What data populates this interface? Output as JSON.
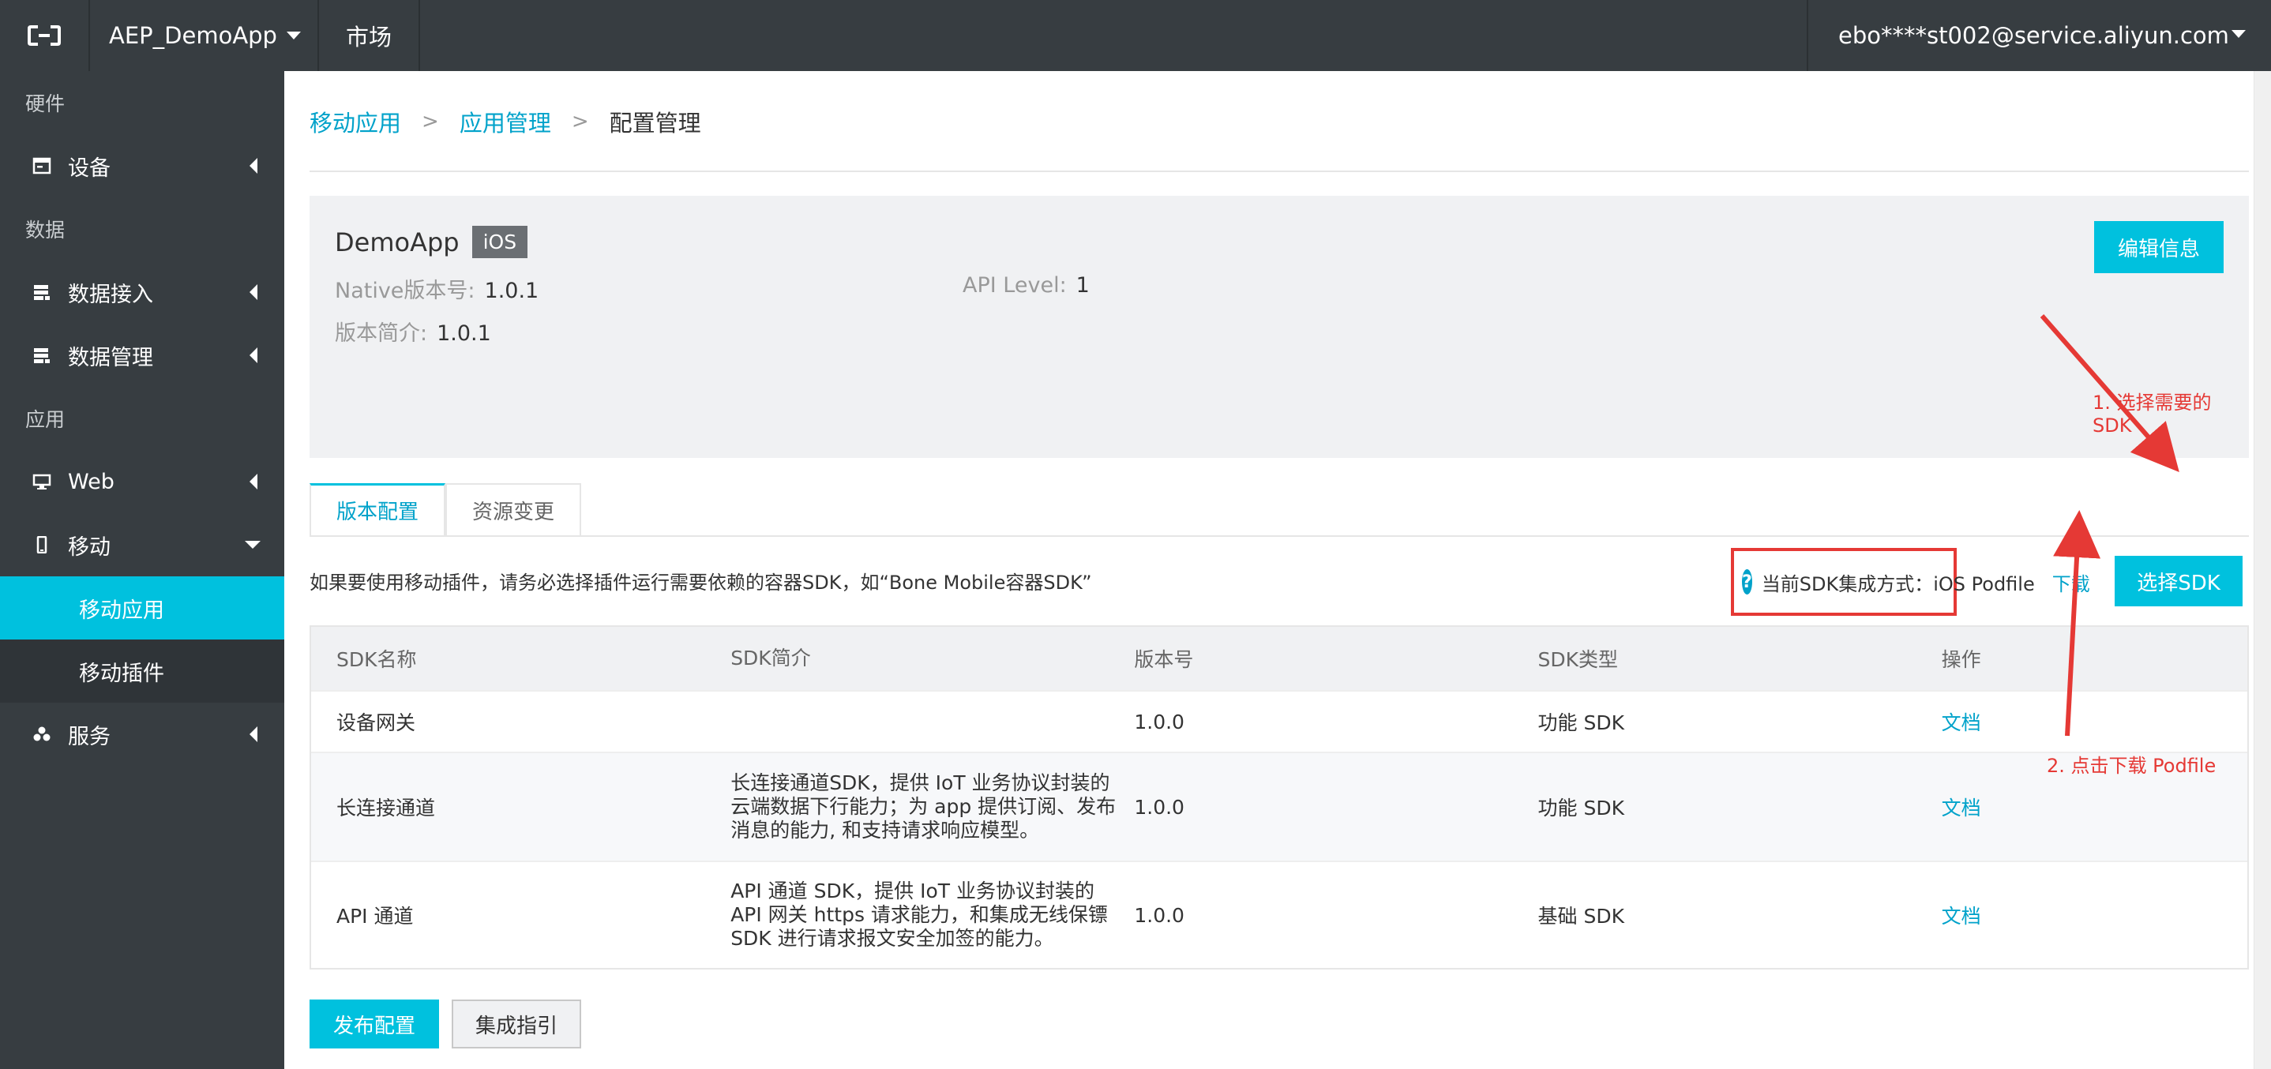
{
  "topbar": {
    "app_name": "AEP_DemoApp",
    "market": "市场",
    "account": "ebo****st002@service.aliyun.com"
  },
  "sidebar": {
    "groups": [
      {
        "label": "硬件"
      },
      {
        "label": "数据"
      },
      {
        "label": "应用"
      }
    ],
    "items": {
      "device": "设备",
      "data_access": "数据接入",
      "data_manage": "数据管理",
      "web": "Web",
      "mobile": "移动",
      "mobile_app": "移动应用",
      "mobile_plugin": "移动插件",
      "service": "服务"
    }
  },
  "breadcrumb": {
    "item1": "移动应用",
    "item2": "应用管理",
    "current": "配置管理",
    "separator": ">"
  },
  "app_info": {
    "name": "DemoApp",
    "platform": "iOS",
    "edit_label": "编辑信息",
    "native_version_label": "Native版本号:",
    "native_version": "1.0.1",
    "api_level_label": "API Level:",
    "api_level": "1",
    "intro_label": "版本简介:",
    "intro": "1.0.1"
  },
  "annotations": {
    "step1": "1. 选择需要的 SDK",
    "step2": "2. 点击下载 Podfile",
    "color": "#e53935"
  },
  "tabs": [
    {
      "label": "版本配置",
      "active": true
    },
    {
      "label": "资源变更",
      "active": false
    }
  ],
  "notice": "如果要使用移动插件，请务必选择插件运行需要依赖的容器SDK，如“Bone Mobile容器SDK”",
  "sdk_mode": {
    "help": "?",
    "text": "当前SDK集成方式：iOS Podfile",
    "download": "下载"
  },
  "select_sdk_label": "选择SDK",
  "table": {
    "headers": [
      "SDK名称",
      "SDK简介",
      "版本号",
      "SDK类型",
      "操作"
    ],
    "rows": [
      {
        "name": "设备网关",
        "desc": "",
        "version": "1.0.0",
        "type": "功能 SDK",
        "action": "文档"
      },
      {
        "name": "长连接通道",
        "desc": "长连接通道SDK，提供 IoT 业务协议封装的云端数据下行能力；为 app 提供订阅、发布消息的能力, 和支持请求响应模型。",
        "version": "1.0.0",
        "type": "功能 SDK",
        "action": "文档"
      },
      {
        "name": "API 通道",
        "desc": "API 通道 SDK，提供 IoT 业务协议封装的 API 网关 https 请求能力，和集成无线保镖 SDK 进行请求报文安全加签的能力。",
        "version": "1.0.0",
        "type": "基础 SDK",
        "action": "文档"
      }
    ]
  },
  "footer": {
    "publish": "发布配置",
    "guide": "集成指引"
  },
  "colors": {
    "topbar": "#373d41",
    "accent": "#00c1de",
    "link": "#00a2ca"
  }
}
